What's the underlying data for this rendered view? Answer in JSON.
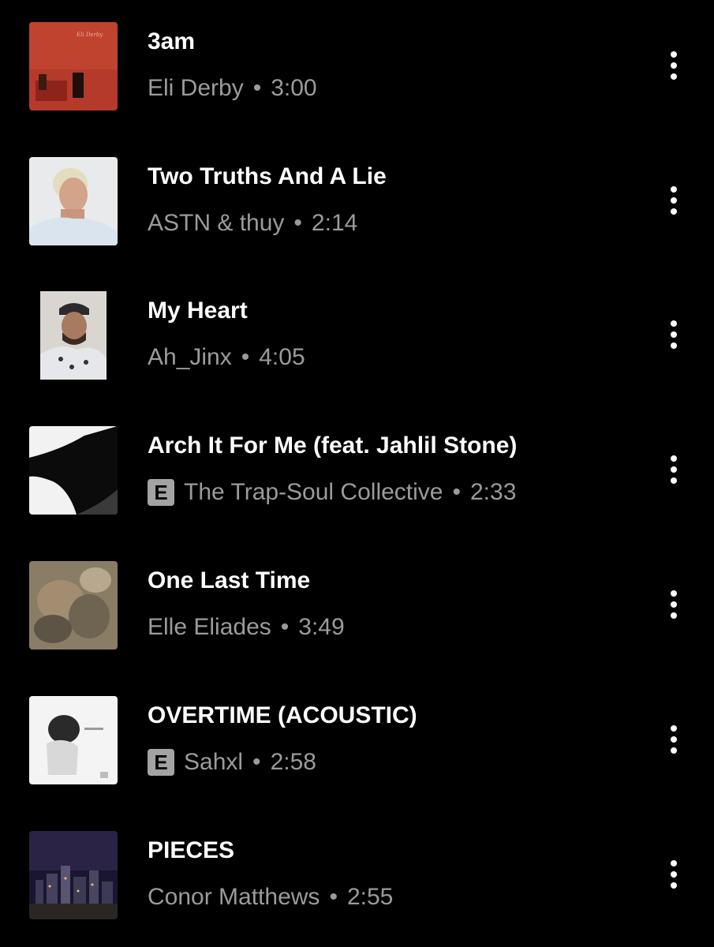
{
  "tracks": [
    {
      "title": "3am",
      "artist": "Eli Derby",
      "duration": "3:00",
      "explicit": false,
      "separator": "•"
    },
    {
      "title": "Two Truths And A Lie",
      "artist": "ASTN & thuy",
      "duration": "2:14",
      "explicit": false,
      "separator": "•"
    },
    {
      "title": "My Heart",
      "artist": "Ah_Jinx",
      "duration": "4:05",
      "explicit": false,
      "separator": "•"
    },
    {
      "title": "Arch It For Me (feat. Jahlil Stone)",
      "artist": "The Trap-Soul Collective",
      "duration": "2:33",
      "explicit": true,
      "explicit_label": "E",
      "separator": "•"
    },
    {
      "title": "One Last Time",
      "artist": "Elle Eliades",
      "duration": "3:49",
      "explicit": false,
      "separator": "•"
    },
    {
      "title": "OVERTIME (ACOUSTIC)",
      "artist": "Sahxl",
      "duration": "2:58",
      "explicit": true,
      "explicit_label": "E",
      "separator": "•"
    },
    {
      "title": "PIECES",
      "artist": "Conor Matthews",
      "duration": "2:55",
      "explicit": false,
      "separator": "•"
    }
  ],
  "icons": {
    "more": "more-vertical-icon",
    "explicit": "explicit-badge"
  },
  "colors": {
    "background": "#000000",
    "title": "#ffffff",
    "subtitle": "#9b9b9b",
    "explicit_badge": "#a3a3a3"
  }
}
